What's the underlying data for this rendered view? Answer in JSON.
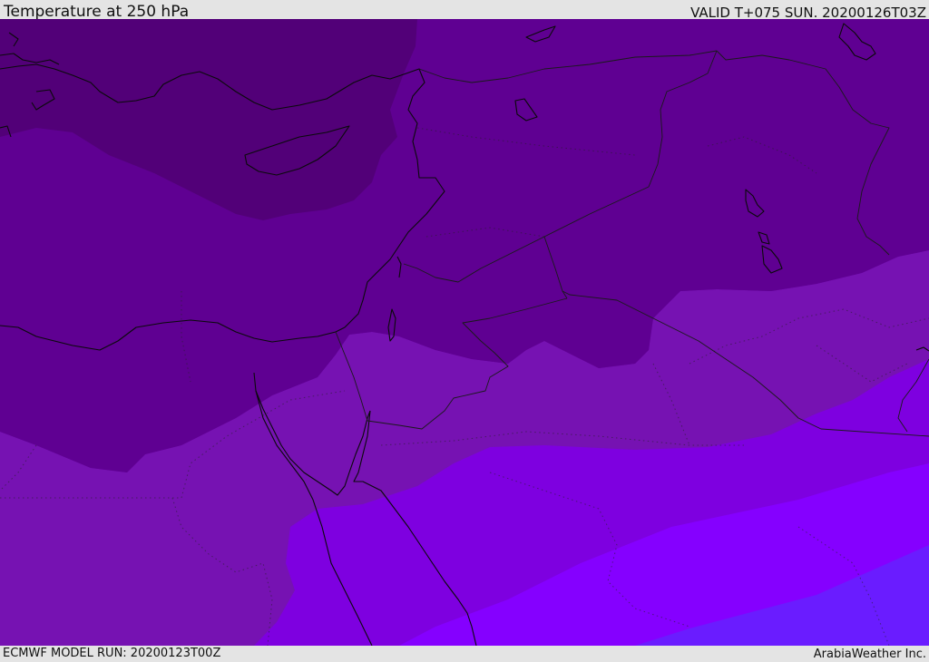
{
  "header": {
    "title": "Temperature at 250 hPa",
    "valid": "VALID T+075 SUN. 20200126T03Z"
  },
  "footer": {
    "model_run": "ECMWF MODEL RUN: 20200123T00Z",
    "credit": "ArabiaWeather Inc."
  },
  "map": {
    "variable": "temperature",
    "level": "250 hPa",
    "region": "Eastern Mediterranean and Levant",
    "colors": {
      "band_darkest": "#520078",
      "band_dark": "#5f0092",
      "band_mid": "#6b00a3",
      "band_light": "#7612b2",
      "band_lighter": "#7e00e0",
      "band_bright": "#8500ff",
      "band_blue": "#6a1cff",
      "coastline": "#0a0a0a"
    }
  }
}
